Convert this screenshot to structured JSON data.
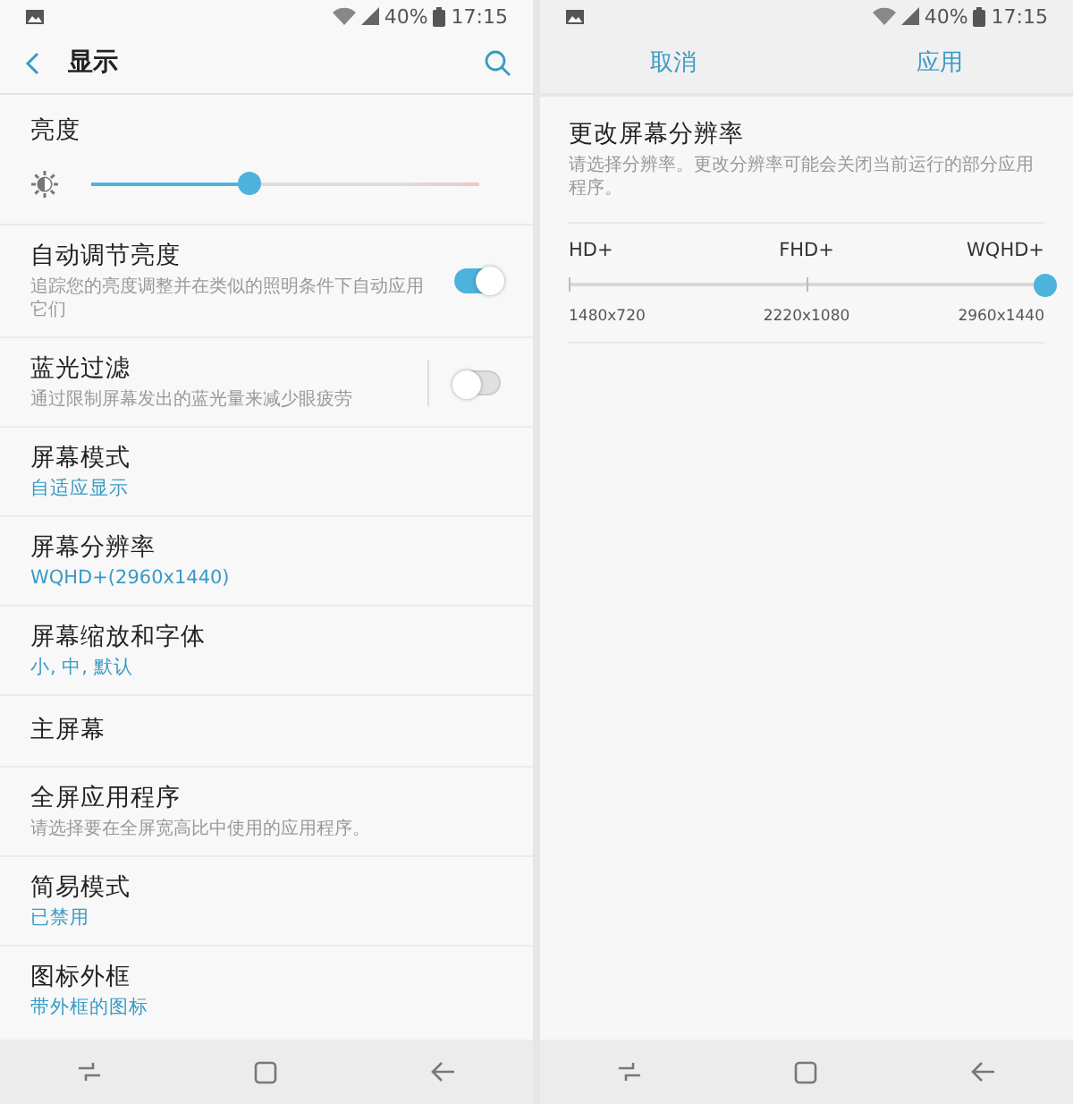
{
  "left": {
    "status_bar": {
      "battery": "40%",
      "time": "17:15"
    },
    "header": {
      "title": "显示"
    },
    "brightness": {
      "label": "亮度",
      "level": 0.41
    },
    "items": [
      {
        "kind": "toggle",
        "title": "自动调节亮度",
        "subtitle": "追踪您的亮度调整并在类似的照明条件下自动应用它们",
        "on": true
      },
      {
        "kind": "toggle",
        "title": "蓝光过滤",
        "subtitle": "通过限制屏幕发出的蓝光量来减少眼疲劳",
        "on": false
      },
      {
        "kind": "value",
        "title": "屏幕模式",
        "subtitle": "自适应显示"
      },
      {
        "kind": "value",
        "title": "屏幕分辨率",
        "subtitle": "WQHD+(2960x1440)"
      },
      {
        "kind": "value",
        "title": "屏幕缩放和字体",
        "subtitle": "小, 中, 默认"
      },
      {
        "kind": "plain",
        "title": "主屏幕"
      },
      {
        "kind": "description",
        "title": "全屏应用程序",
        "subtitle": "请选择要在全屏宽高比中使用的应用程序。"
      },
      {
        "kind": "value",
        "title": "简易模式",
        "subtitle": "已禁用"
      },
      {
        "kind": "value",
        "title": "图标外框",
        "subtitle": "带外框的图标"
      }
    ]
  },
  "right": {
    "status_bar": {
      "battery": "40%",
      "time": "17:15"
    },
    "header": {
      "buttons": [
        "取消",
        "应用"
      ]
    },
    "title": "更改屏幕分辨率",
    "description": "请选择分辨率。更改分辨率可能会关闭当前运行的部分应用程序。",
    "options": [
      {
        "label": "HD+",
        "resolution": "1480x720",
        "selected": false
      },
      {
        "label": "FHD+",
        "resolution": "2220x1080",
        "selected": false
      },
      {
        "label": "WQHD+",
        "resolution": "2960x1440",
        "selected": true
      }
    ]
  }
}
